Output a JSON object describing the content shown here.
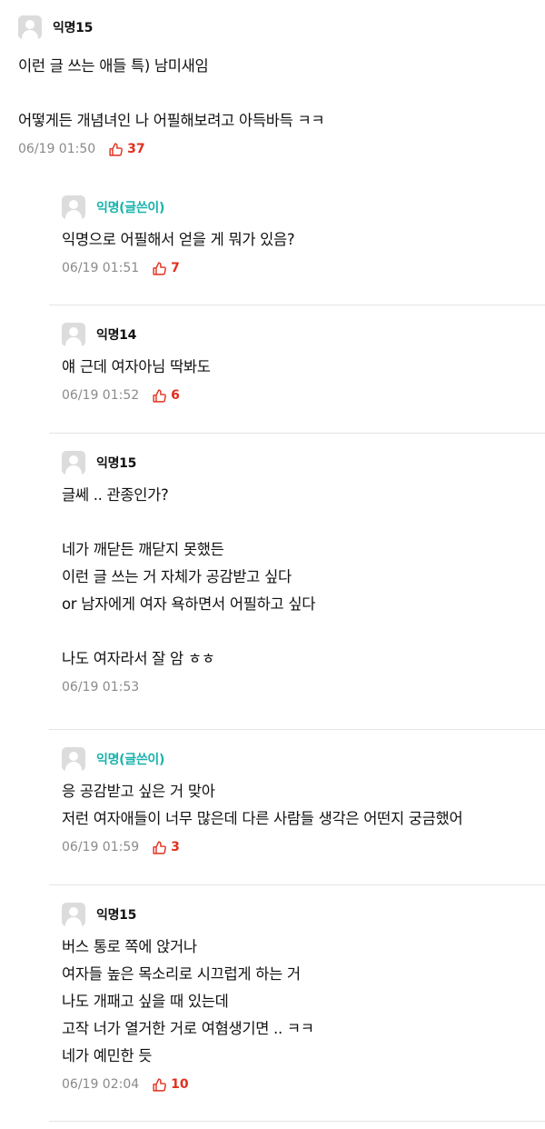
{
  "post": {
    "author": "익명15",
    "lines": [
      "이런 글 쓰는 애들 특) 남미새임",
      "",
      "어떻게든 개념녀인 나 어필해보려고 아득바득 ㅋㅋ"
    ],
    "timestamp": "06/19 01:50",
    "likes": "37"
  },
  "replies": [
    {
      "author": "익명(글쓴이)",
      "lines": [
        "익명으로 어필해서 얻을 게 뭐가 있음?"
      ],
      "timestamp": "06/19 01:51",
      "likes": "7"
    },
    {
      "author": "익명14",
      "lines": [
        "얘 근데 여자아님 딱봐도"
      ],
      "timestamp": "06/19 01:52",
      "likes": "6"
    },
    {
      "author": "익명15",
      "lines": [
        "글쎄 .. 관종인가?",
        "",
        "네가 깨닫든 깨닫지 못했든",
        "이런 글 쓰는 거 자체가 공감받고 싶다",
        "or 남자에게 여자 욕하면서 어필하고 싶다",
        "",
        "나도 여자라서 잘 암 ㅎㅎ"
      ],
      "timestamp": "06/19 01:53",
      "likes": null
    },
    {
      "author": "익명(글쓴이)",
      "lines": [
        "응 공감받고 싶은 거 맞아",
        "저런 여자애들이 너무 많은데 다른 사람들 생각은 어떤지 궁금했어"
      ],
      "timestamp": "06/19 01:59",
      "likes": "3"
    },
    {
      "author": "익명15",
      "lines": [
        "버스 통로 쪽에 앉거나",
        "여자들 높은 목소리로 시끄럽게 하는 거",
        "나도 개패고 싶을 때 있는데",
        "고작 너가 열거한 거로 여혐생기면 .. ㅋㅋ",
        "네가 예민한 듯"
      ],
      "timestamp": "06/19 02:04",
      "likes": "10"
    }
  ]
}
